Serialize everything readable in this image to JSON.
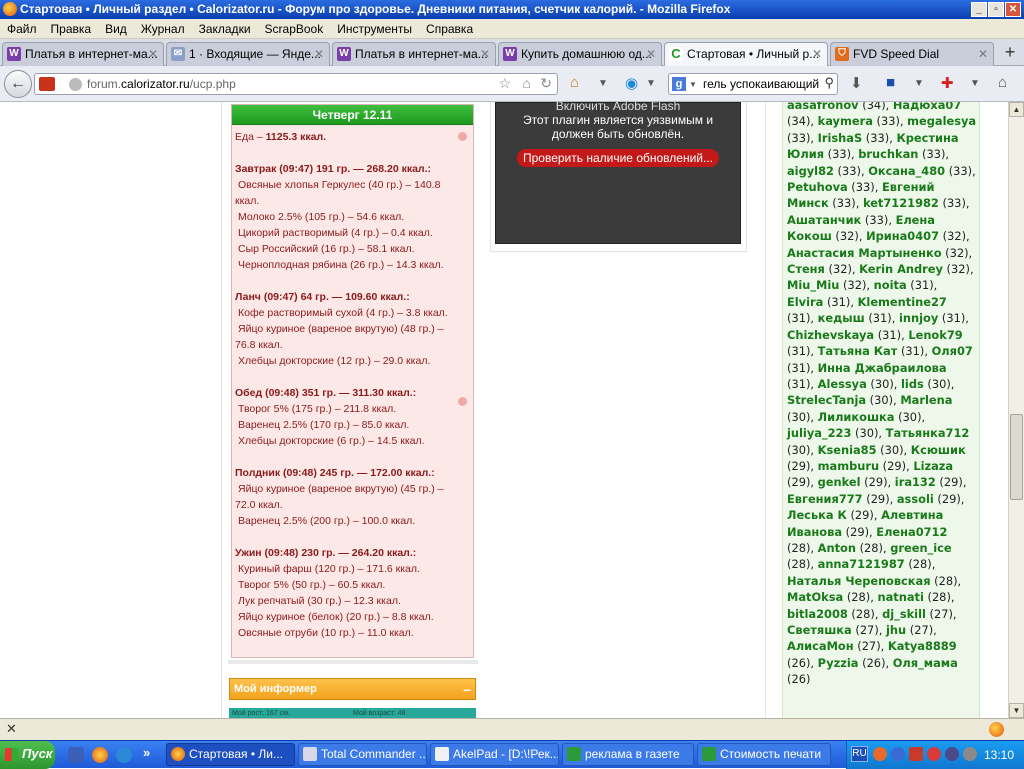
{
  "window": {
    "title": "Стартовая • Личный раздел • Calorizator.ru - Форум про здоровье. Дневники питания, счетчик калорий. - Mozilla Firefox",
    "minimize": "_",
    "maximize": "▫",
    "close": "✕"
  },
  "menu": [
    "Файл",
    "Правка",
    "Вид",
    "Журнал",
    "Закладки",
    "ScrapBook",
    "Инструменты",
    "Справка"
  ],
  "tabs": [
    {
      "label": "Платья в интернет-ма...",
      "icon": "W"
    },
    {
      "label": "1 · Входящие — Янде...",
      "icon": "✉"
    },
    {
      "label": "Платья в интернет-ма...",
      "icon": "W"
    },
    {
      "label": "Купить домашнюю од...",
      "icon": "W"
    },
    {
      "label": "Стартовая • Личный р...",
      "icon": "C"
    },
    {
      "label": "FVD Speed Dial",
      "icon": "⛉"
    }
  ],
  "nav": {
    "url_domain": "forum.",
    "url_host": "calorizator.ru",
    "url_path": "/ucp.php",
    "search_value": "гель успокаивающий",
    "search_engine": "g"
  },
  "diary": {
    "day": "Четверг 12.11",
    "food_total_label": "Еда – ",
    "food_total_value": "1125.3 ккал.",
    "meals": [
      {
        "title": "Завтрак (09:47) 191 гр. — 268.20 ккал.:",
        "items": [
          "Овсяные хлопья Геркулес (40 гр.) – 140.8",
          "ккал.",
          "Молоко 2.5% (105 гр.) – 54.6 ккал.",
          "Цикорий растворимый (4 гр.) – 0.4 ккал.",
          "Сыр Российский (16 гр.) – 58.1 ккал.",
          "Черноплодная рябина (26 гр.) – 14.3 ккал."
        ]
      },
      {
        "title": "Ланч (09:47) 64 гр. — 109.60 ккал.:",
        "items": [
          "Кофе растворимый сухой (4 гр.) – 3.8 ккал.",
          "Яйцо куриное (вареное вкрутую) (48 гр.) –",
          "76.8 ккал.",
          "Хлебцы докторские (12 гр.) – 29.0 ккал."
        ]
      },
      {
        "title": "Обед (09:48) 351 гр. — 311.30 ккал.:",
        "items": [
          "Творог 5% (175 гр.) – 211.8 ккал.",
          "Варенец 2.5% (170 гр.) – 85.0 ккал.",
          "Хлебцы докторские (6 гр.) – 14.5 ккал."
        ]
      },
      {
        "title": "Полдник (09:48) 245 гр. — 172.00 ккал.:",
        "items": [
          "Яйцо куриное (вареное вкрутую) (45 гр.) –",
          "72.0 ккал.",
          "Варенец 2.5% (200 гр.) – 100.0 ккал."
        ]
      },
      {
        "title": "Ужин (09:48) 230 гр. — 264.20 ккал.:",
        "items": [
          "Куриный фарш (120 гр.) – 171.6 ккал.",
          "Творог 5% (50 гр.) – 60.5 ккал.",
          "Лук репчатый (30 гр.) – 12.3 ккал.",
          "Яйцо куриное (белок) (20 гр.) – 8.8 ккал.",
          "Овсяные отруби (10 гр.) – 11.0 ккал."
        ]
      }
    ]
  },
  "flash": {
    "line0": "Включить Adobe Flash",
    "line1": "Этот плагин является уязвимым и",
    "line2": "должен быть обновлён.",
    "button": "Проверить наличие обновлений..."
  },
  "informer": {
    "title": "Мой информер",
    "minimize": "–",
    "height_label": "Мой рост: 167 см.",
    "age_label": "Мой возраст: 48"
  },
  "users": [
    {
      "n": "aasafronov",
      "c": "34"
    },
    {
      "n": "Надюха07",
      "c": "34"
    },
    {
      "n": "kaymera",
      "c": "33"
    },
    {
      "n": "megalesya",
      "c": "33"
    },
    {
      "n": "IrishaS",
      "c": "33"
    },
    {
      "n": "Крестина Юлия",
      "c": "33"
    },
    {
      "n": "bruchkan",
      "c": "33"
    },
    {
      "n": "aigyl82",
      "c": "33"
    },
    {
      "n": "Оксана_480",
      "c": "33"
    },
    {
      "n": "Petuhova",
      "c": "33"
    },
    {
      "n": "Евгений Минск",
      "c": "33"
    },
    {
      "n": "ket7121982",
      "c": "33"
    },
    {
      "n": "Ашатанчик",
      "c": "33"
    },
    {
      "n": "Елена Кокош",
      "c": "32"
    },
    {
      "n": "Ирина0407",
      "c": "32"
    },
    {
      "n": "Анастасия Мартыненко",
      "c": "32"
    },
    {
      "n": "Стеня",
      "c": "32"
    },
    {
      "n": "Kerin Andrey",
      "c": "32"
    },
    {
      "n": "Miu_Miu",
      "c": "32"
    },
    {
      "n": "noita",
      "c": "31"
    },
    {
      "n": "Elvira",
      "c": "31"
    },
    {
      "n": "Klementine27",
      "c": "31"
    },
    {
      "n": "кедыш",
      "c": "31"
    },
    {
      "n": "innjoy",
      "c": "31"
    },
    {
      "n": "Chizhevskaya",
      "c": "31"
    },
    {
      "n": "Lenok79",
      "c": "31"
    },
    {
      "n": "Татьяна Кат",
      "c": "31"
    },
    {
      "n": "Оля07",
      "c": "31"
    },
    {
      "n": "Инна Джабраилова",
      "c": "31"
    },
    {
      "n": "Alessya",
      "c": "30"
    },
    {
      "n": "lids",
      "c": "30"
    },
    {
      "n": "StrelecTanja",
      "c": "30"
    },
    {
      "n": "Marlena",
      "c": "30"
    },
    {
      "n": "Лиликошка",
      "c": "30"
    },
    {
      "n": "juliya_223",
      "c": "30"
    },
    {
      "n": "Татьянка712",
      "c": "30"
    },
    {
      "n": "Ksenia85",
      "c": "30"
    },
    {
      "n": "Ксюшик",
      "c": "29"
    },
    {
      "n": "mamburu",
      "c": "29"
    },
    {
      "n": "Lizaza",
      "c": "29"
    },
    {
      "n": "genkel",
      "c": "29"
    },
    {
      "n": "ira132",
      "c": "29"
    },
    {
      "n": "Евгения777",
      "c": "29"
    },
    {
      "n": "assoli",
      "c": "29"
    },
    {
      "n": "Леська К",
      "c": "29"
    },
    {
      "n": "Алевтина Иванова",
      "c": "29"
    },
    {
      "n": "Елена0712",
      "c": "28"
    },
    {
      "n": "Anton",
      "c": "28"
    },
    {
      "n": "green_ice",
      "c": "28"
    },
    {
      "n": "anna7121987",
      "c": "28"
    },
    {
      "n": "Наталья Череповская",
      "c": "28"
    },
    {
      "n": "MatOksa",
      "c": "28"
    },
    {
      "n": "natnati",
      "c": "28"
    },
    {
      "n": "bitla2008",
      "c": "28"
    },
    {
      "n": "dj_skill",
      "c": "27"
    },
    {
      "n": "Светяшка",
      "c": "27"
    },
    {
      "n": "jhu",
      "c": "27"
    },
    {
      "n": "АлисаМон",
      "c": "27"
    },
    {
      "n": "Katya8889",
      "c": "26"
    },
    {
      "n": "Pyzzia",
      "c": "26"
    },
    {
      "n": "Оля_мама",
      "c": "26"
    }
  ],
  "taskbar": {
    "start": "Пуск",
    "more": "»",
    "tasks": [
      "Стартовая • Ли...",
      "Total Commander ...",
      "AkelPad - [D:\\!Рек...",
      "реклама в газете",
      "Стоимость печати"
    ],
    "lang": "RU",
    "clock": "13:10"
  },
  "colors": {
    "accent_green": "#1e9a1e",
    "diary_text": "#8b1a1a",
    "diary_bg": "#fde8e8",
    "informer": "#f2a21c",
    "user_name": "#1a7a1a"
  }
}
